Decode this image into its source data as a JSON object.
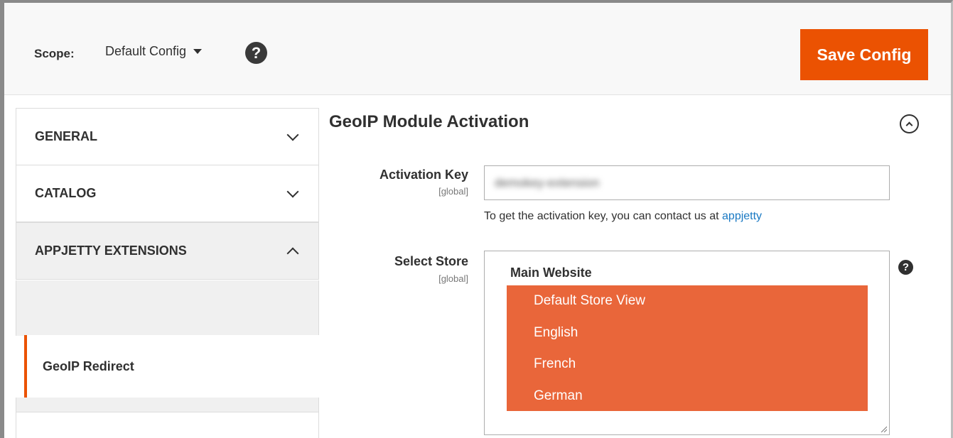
{
  "scope": {
    "label": "Scope:",
    "selected": "Default Config"
  },
  "toolbar": {
    "save_label": "Save Config",
    "help_glyph": "?"
  },
  "sidebar": {
    "sections": [
      {
        "label": "GENERAL",
        "state": "collapsed"
      },
      {
        "label": "CATALOG",
        "state": "collapsed"
      },
      {
        "label": "APPJETTY EXTENSIONS",
        "state": "expanded"
      }
    ],
    "active_item": "GeoIP Redirect"
  },
  "main": {
    "section_title": "GeoIP Module Activation",
    "activation": {
      "label": "Activation Key",
      "scope": "[global]",
      "value_blurred": "demokey-extension",
      "note_text": "To get the activation key, you can contact us at ",
      "note_link": "appjetty"
    },
    "store": {
      "label": "Select Store",
      "scope": "[global]",
      "group": "Main Website",
      "options": [
        "Default Store View",
        "English",
        "French",
        "German"
      ],
      "help_glyph": "?"
    }
  },
  "colors": {
    "accent": "#eb5202",
    "selected_option_bg": "#e9663a",
    "link": "#1979c3"
  }
}
